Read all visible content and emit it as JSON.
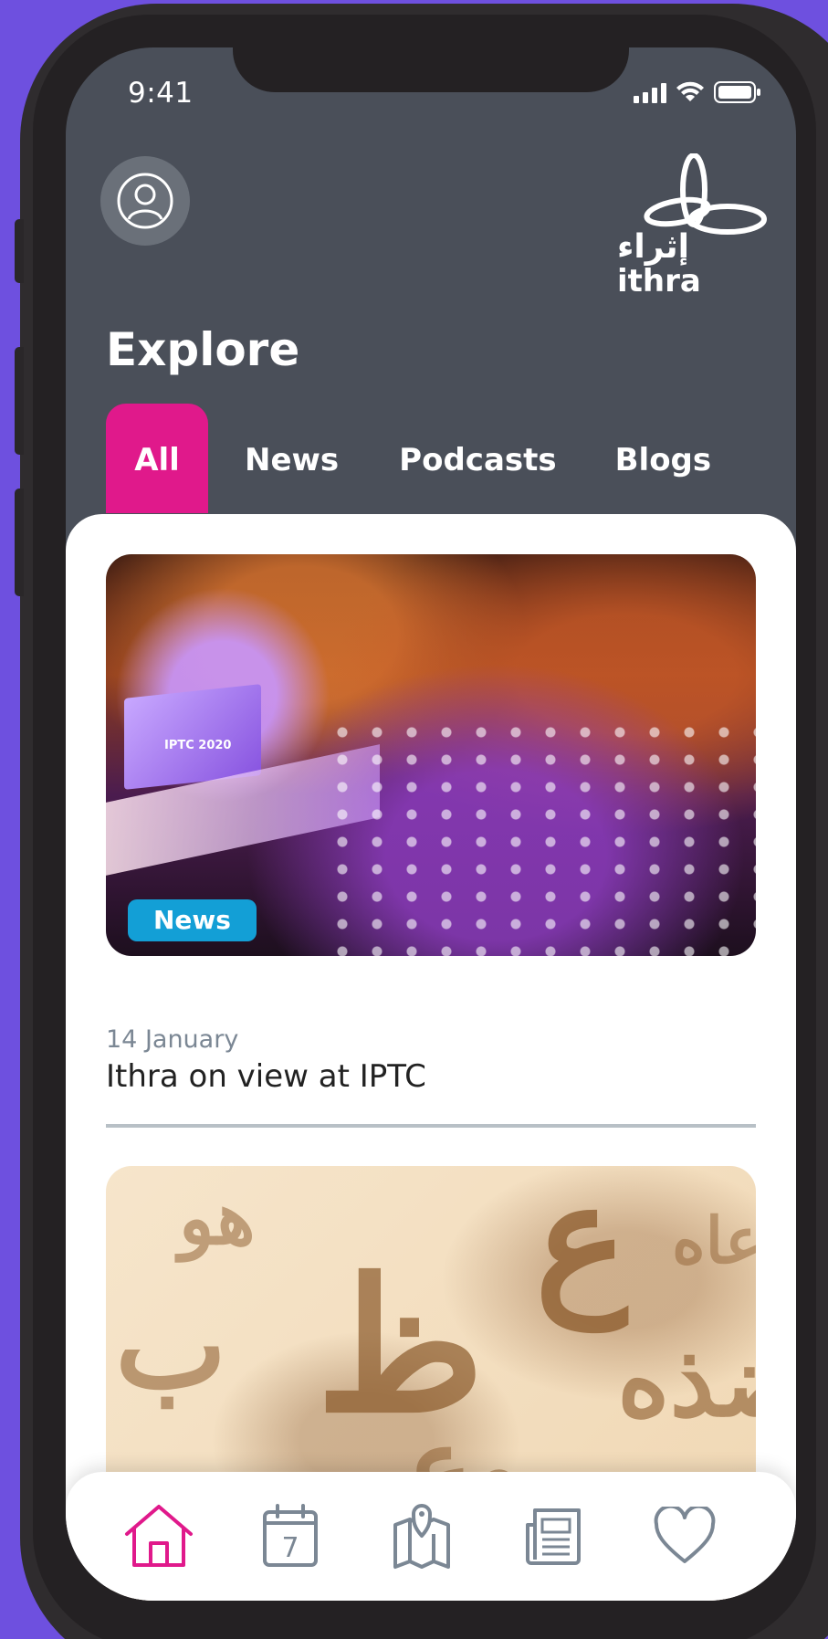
{
  "status_bar": {
    "time": "9:41"
  },
  "header": {
    "logo_arabic": "إثراء",
    "logo_english": "ithra",
    "title": "Explore"
  },
  "tabs": [
    {
      "label": "All",
      "active": true
    },
    {
      "label": "News",
      "active": false
    },
    {
      "label": "Podcasts",
      "active": false
    },
    {
      "label": "Blogs",
      "active": false
    }
  ],
  "feed": [
    {
      "image_caption": "IPTC 2020",
      "badge": "News",
      "date": "14 January",
      "title": "Ithra on view at IPTC"
    }
  ],
  "bottom_nav": [
    {
      "icon": "home-icon",
      "active": true
    },
    {
      "icon": "calendar-icon",
      "label": "7",
      "active": false
    },
    {
      "icon": "map-icon",
      "active": false
    },
    {
      "icon": "news-icon",
      "active": false
    },
    {
      "icon": "heart-icon",
      "active": false
    }
  ],
  "colors": {
    "accent": "#e0198b",
    "badge_blue": "#139fd6",
    "header_bg": "#4a4f59",
    "inactive_icon": "#7b8794",
    "outer_bg": "#6e50df"
  }
}
